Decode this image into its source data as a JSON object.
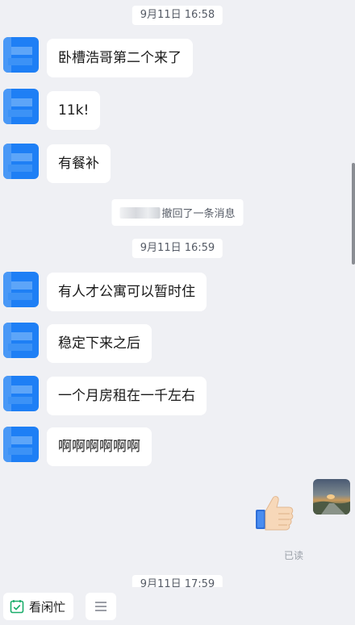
{
  "chat": {
    "time_separators": [
      "9月11日 16:58",
      "9月11日 16:59",
      "9月11日 17:59"
    ],
    "messages": [
      {
        "text": "卧槽浩哥第二个来了"
      },
      {
        "text": "11k!"
      },
      {
        "text": "有餐补"
      },
      {
        "text": "有人才公寓可以暂时住"
      },
      {
        "text": "稳定下来之后"
      },
      {
        "text": "一个月房租在一千左右"
      },
      {
        "text": "啊啊啊啊啊啊"
      }
    ],
    "recall_notice": "撤回了一条消息",
    "self": {
      "sticker": "thumbs-up-icon",
      "read_status": "已读"
    }
  },
  "bottom_bar": {
    "busy_label": "看闲忙",
    "busy_icon": "calendar-check-icon",
    "menu_icon": "menu-icon"
  },
  "colors": {
    "background": "#eff0f4",
    "avatar_blue": "#1e7ff5",
    "bubble": "#ffffff",
    "check_green": "#1aad6a"
  }
}
